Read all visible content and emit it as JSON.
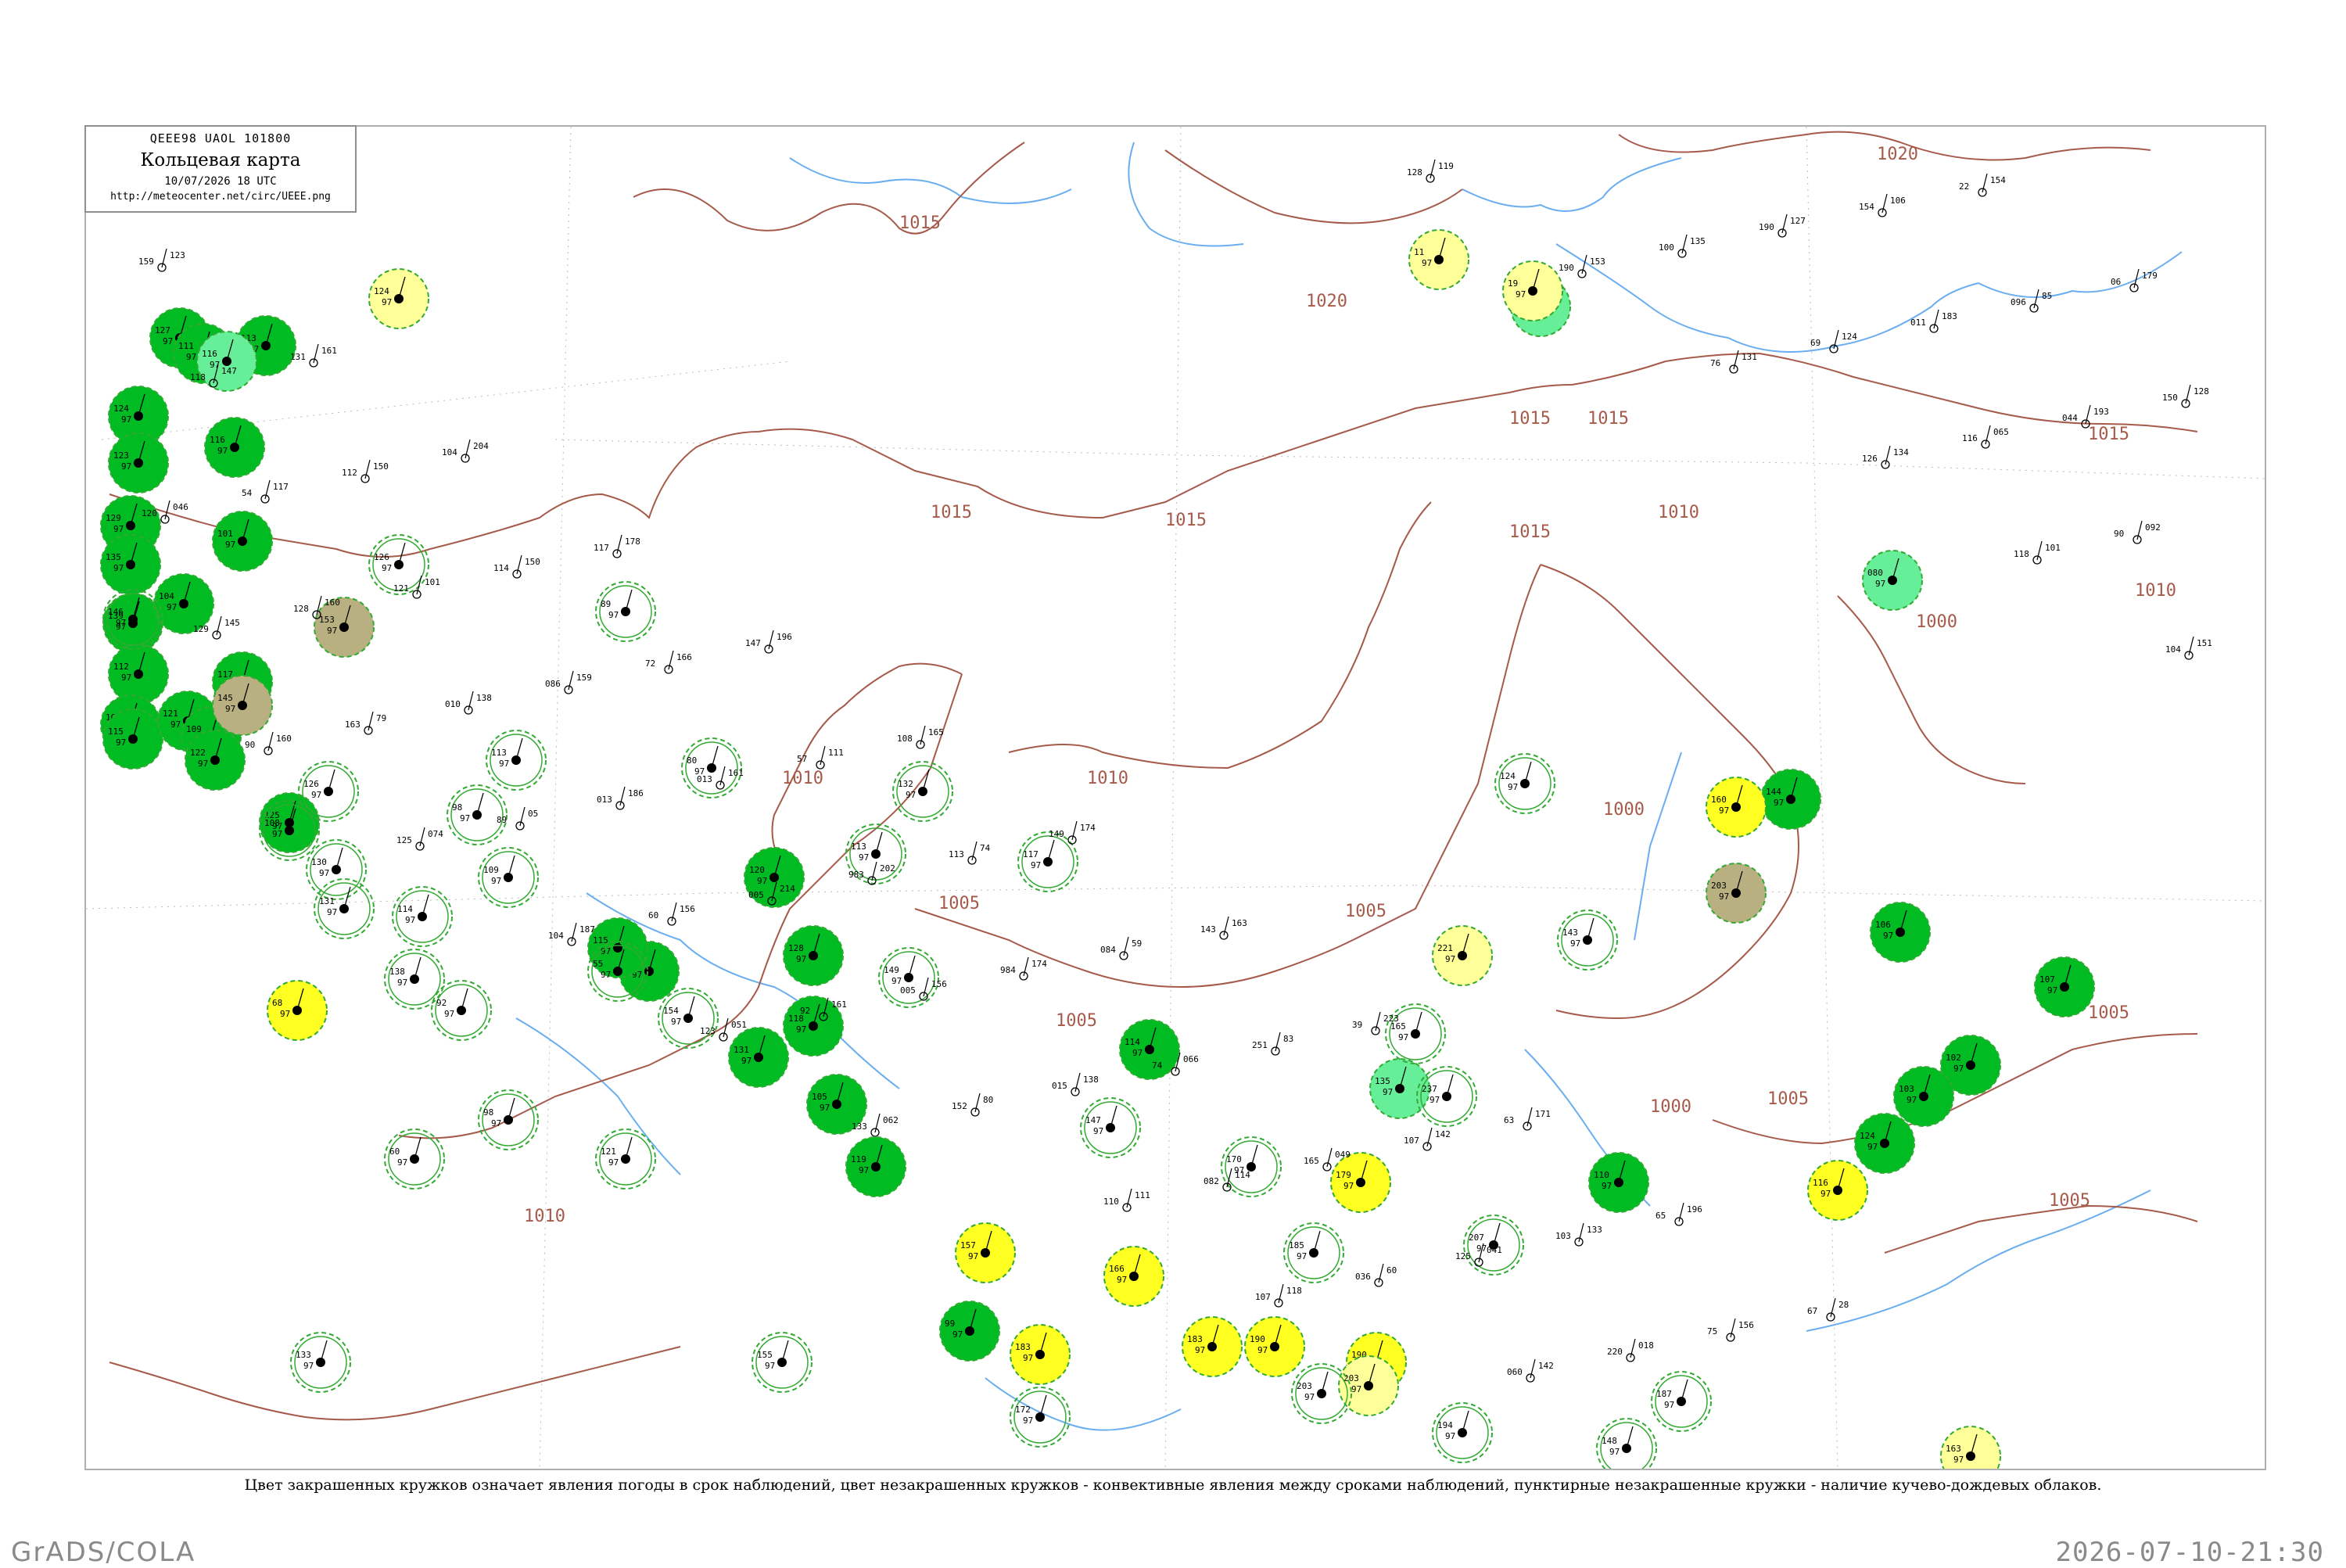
{
  "header": {
    "code": "QEEE98  UAOL  101800",
    "title": "Кольцевая карта",
    "date": "10/07/2026 18 UTC",
    "url": "http://meteocenter.net/circ/UEEE.png"
  },
  "caption": "Цвет закрашенных кружков означает явления погоды в срок наблюдений, цвет незакрашенных кружков - конвективные явления между сроками наблюдений, пунктирные незакрашенные кружки - наличие кучево-дождевых облаков.",
  "footer": {
    "left": "GrADS/COLA",
    "right": "2026-07-10-21:30"
  },
  "colors": {
    "rain": "#00bb22",
    "shower": "#66ee99",
    "fog": "#ffff22",
    "haze": "#ffff99",
    "dust": "#b8b080",
    "cb_dashed": "#33aa33",
    "thunder_ring": "#dd4444",
    "isobar": "#a65a4a",
    "river": "#6aaef0",
    "grid": "#bbbbbb"
  },
  "isobar_labels": [
    "1020",
    "1015",
    "1015",
    "1015",
    "1015",
    "1015",
    "1015",
    "1015",
    "1010",
    "1010",
    "1010",
    "1010",
    "1010",
    "1005",
    "1005",
    "1005",
    "1005",
    "1005",
    "1005",
    "1000",
    "1000",
    "1000",
    "1020"
  ],
  "stations": [
    {
      "kind": "rain",
      "num": "124",
      "name": ""
    },
    {
      "kind": "rain",
      "num": "123",
      "name": ""
    },
    {
      "kind": "rain",
      "num": "129",
      "name": ""
    },
    {
      "kind": "rain",
      "num": "135",
      "name": ""
    },
    {
      "kind": "rain",
      "num": "139",
      "name": ""
    },
    {
      "kind": "rain",
      "num": "112",
      "name": ""
    },
    {
      "kind": "rain",
      "num": "108",
      "name": ""
    },
    {
      "kind": "rain",
      "num": "115",
      "name": ""
    },
    {
      "kind": "rain",
      "num": "104",
      "name": ""
    },
    {
      "kind": "rain",
      "num": "121",
      "name": ""
    },
    {
      "kind": "rain",
      "num": "127",
      "name": ""
    },
    {
      "kind": "rain",
      "num": "111",
      "name": ""
    },
    {
      "kind": "rain",
      "num": "113",
      "name": ""
    },
    {
      "kind": "rain",
      "num": "116",
      "name": ""
    },
    {
      "kind": "rain",
      "num": "101",
      "name": ""
    },
    {
      "kind": "rain",
      "num": "109",
      "name": ""
    },
    {
      "kind": "rain",
      "num": "122",
      "name": ""
    },
    {
      "kind": "rain",
      "num": "117",
      "name": ""
    },
    {
      "kind": "rain",
      "num": "125",
      "name": ""
    },
    {
      "kind": "rain",
      "num": "131",
      "name": ""
    },
    {
      "kind": "rain",
      "num": "128",
      "name": ""
    },
    {
      "kind": "rain",
      "num": "120",
      "name": ""
    },
    {
      "kind": "rain",
      "num": "118",
      "name": ""
    },
    {
      "kind": "rain",
      "num": "105",
      "name": ""
    },
    {
      "kind": "rain",
      "num": "119",
      "name": ""
    },
    {
      "kind": "rain",
      "num": "114",
      "name": ""
    },
    {
      "kind": "rain",
      "num": "110",
      "name": ""
    },
    {
      "kind": "rain",
      "num": "106",
      "name": ""
    },
    {
      "kind": "rain",
      "num": "144",
      "name": ""
    },
    {
      "kind": "rain",
      "num": "102",
      "name": ""
    },
    {
      "kind": "rain",
      "num": "103",
      "name": ""
    },
    {
      "kind": "rain",
      "num": "107",
      "name": ""
    },
    {
      "kind": "rain",
      "num": "124",
      "name": ""
    },
    {
      "kind": "rain",
      "num": "128",
      "name": ""
    },
    {
      "kind": "rain",
      "num": "115",
      "name": ""
    },
    {
      "kind": "rain",
      "num": "99",
      "name": ""
    },
    {
      "kind": "shower",
      "num": "116",
      "name": ""
    },
    {
      "kind": "shower",
      "num": "135",
      "name": ""
    },
    {
      "kind": "shower",
      "num": "02",
      "name": ""
    },
    {
      "kind": "shower",
      "num": "080",
      "name": ""
    },
    {
      "kind": "fog",
      "num": "68",
      "name": ""
    },
    {
      "kind": "fog",
      "num": "160",
      "name": ""
    },
    {
      "kind": "fog",
      "num": "116",
      "name": ""
    },
    {
      "kind": "fog",
      "num": "157",
      "name": ""
    },
    {
      "kind": "fog",
      "num": "183",
      "name": ""
    },
    {
      "kind": "fog",
      "num": "166",
      "name": ""
    },
    {
      "kind": "fog",
      "num": "183",
      "name": ""
    },
    {
      "kind": "fog",
      "num": "190",
      "name": ""
    },
    {
      "kind": "fog",
      "num": "179",
      "name": ""
    },
    {
      "kind": "fog",
      "num": "190",
      "name": ""
    },
    {
      "kind": "haze",
      "num": "124",
      "name": ""
    },
    {
      "kind": "haze",
      "num": "11",
      "name": ""
    },
    {
      "kind": "haze",
      "num": "19",
      "name": ""
    },
    {
      "kind": "haze",
      "num": "221",
      "name": ""
    },
    {
      "kind": "haze",
      "num": "203",
      "name": ""
    },
    {
      "kind": "haze",
      "num": "163",
      "name": ""
    },
    {
      "kind": "dust",
      "num": "153",
      "name": ""
    },
    {
      "kind": "dust",
      "num": "145",
      "name": ""
    },
    {
      "kind": "dust",
      "num": "203",
      "name": ""
    },
    {
      "kind": "cb",
      "num": "146",
      "name": ""
    },
    {
      "kind": "cb",
      "num": "80",
      "name": ""
    },
    {
      "kind": "cb",
      "num": "89",
      "name": ""
    },
    {
      "kind": "cb",
      "num": "132",
      "name": ""
    },
    {
      "kind": "cb",
      "num": "113",
      "name": ""
    },
    {
      "kind": "cb",
      "num": "117",
      "name": ""
    },
    {
      "kind": "cb",
      "num": "126",
      "name": ""
    },
    {
      "kind": "cb",
      "num": "113",
      "name": ""
    },
    {
      "kind": "cb",
      "num": "114",
      "name": ""
    },
    {
      "kind": "cb",
      "num": "92",
      "name": ""
    },
    {
      "kind": "cb",
      "num": "60",
      "name": ""
    },
    {
      "kind": "cb",
      "num": "98",
      "name": ""
    },
    {
      "kind": "cb",
      "num": "237",
      "name": ""
    },
    {
      "kind": "cb",
      "num": "124",
      "name": ""
    },
    {
      "kind": "cb",
      "num": "143",
      "name": ""
    },
    {
      "kind": "cb",
      "num": "147",
      "name": ""
    },
    {
      "kind": "cb",
      "num": "170",
      "name": ""
    },
    {
      "kind": "cb",
      "num": "185",
      "name": ""
    },
    {
      "kind": "cb",
      "num": "207",
      "name": ""
    },
    {
      "kind": "cb",
      "num": "194",
      "name": ""
    },
    {
      "kind": "cb",
      "num": "148",
      "name": ""
    },
    {
      "kind": "cb",
      "num": "187",
      "name": ""
    },
    {
      "kind": "cb",
      "num": "172",
      "name": ""
    },
    {
      "kind": "cb",
      "num": "155",
      "name": ""
    },
    {
      "kind": "cb",
      "num": "203",
      "name": ""
    },
    {
      "kind": "cb",
      "num": "165",
      "name": ""
    },
    {
      "kind": "cb",
      "num": "108",
      "name": ""
    },
    {
      "kind": "cb",
      "num": "126",
      "name": ""
    },
    {
      "kind": "cb",
      "num": "130",
      "name": ""
    },
    {
      "kind": "cb",
      "num": "131",
      "name": ""
    },
    {
      "kind": "cb",
      "num": "138",
      "name": ""
    },
    {
      "kind": "cb",
      "num": "55",
      "name": ""
    },
    {
      "kind": "cb",
      "num": "154",
      "name": ""
    },
    {
      "kind": "cb",
      "num": "121",
      "name": ""
    },
    {
      "kind": "cb",
      "num": "133",
      "name": ""
    },
    {
      "kind": "cb",
      "num": "98",
      "name": ""
    },
    {
      "kind": "cb",
      "num": "109",
      "name": ""
    },
    {
      "kind": "cb",
      "num": "149",
      "name": ""
    }
  ],
  "plain_stations": [
    {
      "num": "159"
    },
    {
      "num": "123"
    },
    {
      "num": "131"
    },
    {
      "num": "161"
    },
    {
      "num": "104"
    },
    {
      "num": "204"
    },
    {
      "num": "117"
    },
    {
      "num": "178"
    },
    {
      "num": "147"
    },
    {
      "num": "196"
    },
    {
      "num": "108"
    },
    {
      "num": "165"
    },
    {
      "num": "149"
    },
    {
      "num": "174"
    },
    {
      "num": "143"
    },
    {
      "num": "163"
    },
    {
      "num": "39"
    },
    {
      "num": "223"
    },
    {
      "num": "63"
    },
    {
      "num": "171"
    },
    {
      "num": "65"
    },
    {
      "num": "196"
    },
    {
      "num": "67"
    },
    {
      "num": "28"
    },
    {
      "num": "22"
    },
    {
      "num": "154"
    },
    {
      "num": "06"
    },
    {
      "num": "179"
    },
    {
      "num": "118"
    },
    {
      "num": "147"
    },
    {
      "num": "112"
    },
    {
      "num": "150"
    },
    {
      "num": "114"
    },
    {
      "num": "150"
    },
    {
      "num": "72"
    },
    {
      "num": "166"
    },
    {
      "num": "57"
    },
    {
      "num": "111"
    },
    {
      "num": "113"
    },
    {
      "num": "74"
    },
    {
      "num": "084"
    },
    {
      "num": "59"
    },
    {
      "num": "251"
    },
    {
      "num": "83"
    },
    {
      "num": "107"
    },
    {
      "num": "142"
    },
    {
      "num": "103"
    },
    {
      "num": "133"
    },
    {
      "num": "75"
    },
    {
      "num": "156"
    },
    {
      "num": "154"
    },
    {
      "num": "106"
    },
    {
      "num": "096"
    },
    {
      "num": "85"
    },
    {
      "num": "150"
    },
    {
      "num": "128"
    },
    {
      "num": "54"
    },
    {
      "num": "117"
    },
    {
      "num": "121"
    },
    {
      "num": "101"
    },
    {
      "num": "086"
    },
    {
      "num": "159"
    },
    {
      "num": "013"
    },
    {
      "num": "161"
    },
    {
      "num": "983"
    },
    {
      "num": "202"
    },
    {
      "num": "984"
    },
    {
      "num": "174"
    },
    {
      "num": "74"
    },
    {
      "num": "066"
    },
    {
      "num": "165"
    },
    {
      "num": "049"
    },
    {
      "num": "125"
    },
    {
      "num": "041"
    },
    {
      "num": "220"
    },
    {
      "num": "018"
    },
    {
      "num": "190"
    },
    {
      "num": "127"
    },
    {
      "num": "011"
    },
    {
      "num": "183"
    },
    {
      "num": "044"
    },
    {
      "num": "193"
    },
    {
      "num": "120"
    },
    {
      "num": "046"
    },
    {
      "num": "128"
    },
    {
      "num": "160"
    },
    {
      "num": "010"
    },
    {
      "num": "138"
    },
    {
      "num": "013"
    },
    {
      "num": "186"
    },
    {
      "num": "005"
    },
    {
      "num": "214"
    },
    {
      "num": "005"
    },
    {
      "num": "156"
    },
    {
      "num": "015"
    },
    {
      "num": "138"
    },
    {
      "num": "082"
    },
    {
      "num": "114"
    },
    {
      "num": "036"
    },
    {
      "num": "60"
    },
    {
      "num": "060"
    },
    {
      "num": "142"
    },
    {
      "num": "100"
    },
    {
      "num": "135"
    },
    {
      "num": "69"
    },
    {
      "num": "124"
    },
    {
      "num": "116"
    },
    {
      "num": "065"
    },
    {
      "num": "90"
    },
    {
      "num": "092"
    },
    {
      "num": "129"
    },
    {
      "num": "145"
    },
    {
      "num": "163"
    },
    {
      "num": "79"
    },
    {
      "num": "89"
    },
    {
      "num": "05"
    },
    {
      "num": "60"
    },
    {
      "num": "156"
    },
    {
      "num": "92"
    },
    {
      "num": "161"
    },
    {
      "num": "152"
    },
    {
      "num": "80"
    },
    {
      "num": "110"
    },
    {
      "num": "111"
    },
    {
      "num": "107"
    },
    {
      "num": "118"
    },
    {
      "num": "128"
    },
    {
      "num": "119"
    },
    {
      "num": "190"
    },
    {
      "num": "153"
    },
    {
      "num": "76"
    },
    {
      "num": "131"
    },
    {
      "num": "126"
    },
    {
      "num": "134"
    },
    {
      "num": "118"
    },
    {
      "num": "101"
    },
    {
      "num": "104"
    },
    {
      "num": "151"
    },
    {
      "num": "90"
    },
    {
      "num": "160"
    },
    {
      "num": "125"
    },
    {
      "num": "074"
    },
    {
      "num": "104"
    },
    {
      "num": "187"
    },
    {
      "num": "123"
    },
    {
      "num": "051"
    },
    {
      "num": "133"
    },
    {
      "num": "062"
    }
  ]
}
